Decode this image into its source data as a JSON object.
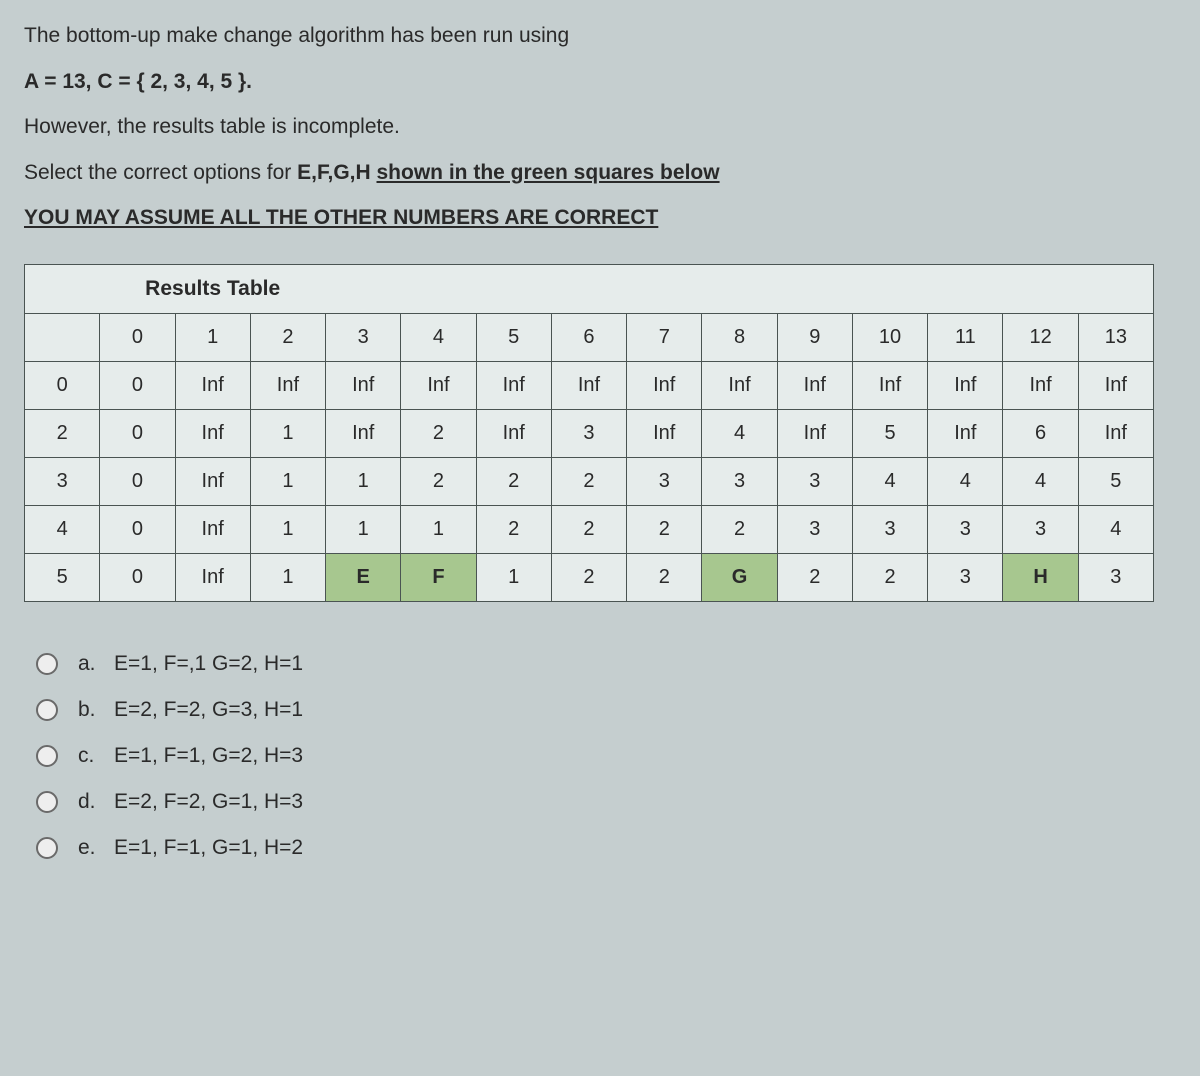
{
  "question": {
    "line1": "The bottom-up make change algorithm has been run using",
    "line2": "A = 13, C = { 2, 3, 4, 5 }.",
    "line3": "However, the results table is incomplete.",
    "line4_prefix": "Select the correct options for ",
    "line4_bold": "E,F,G,H ",
    "line4_underline": "shown in the green squares below",
    "line5": "YOU MAY ASSUME ALL THE OTHER NUMBERS ARE CORRECT"
  },
  "table": {
    "title": "Results Table",
    "col_headers": [
      "0",
      "1",
      "2",
      "3",
      "4",
      "5",
      "6",
      "7",
      "8",
      "9",
      "10",
      "11",
      "12",
      "13"
    ],
    "rows": [
      {
        "label": "0",
        "cells": [
          "0",
          "Inf",
          "Inf",
          "Inf",
          "Inf",
          "Inf",
          "Inf",
          "Inf",
          "Inf",
          "Inf",
          "Inf",
          "Inf",
          "Inf",
          "Inf"
        ],
        "green_indices": []
      },
      {
        "label": "2",
        "cells": [
          "0",
          "Inf",
          "1",
          "Inf",
          "2",
          "Inf",
          "3",
          "Inf",
          "4",
          "Inf",
          "5",
          "Inf",
          "6",
          "Inf"
        ],
        "green_indices": []
      },
      {
        "label": "3",
        "cells": [
          "0",
          "Inf",
          "1",
          "1",
          "2",
          "2",
          "2",
          "3",
          "3",
          "3",
          "4",
          "4",
          "4",
          "5"
        ],
        "green_indices": []
      },
      {
        "label": "4",
        "cells": [
          "0",
          "Inf",
          "1",
          "1",
          "1",
          "2",
          "2",
          "2",
          "2",
          "3",
          "3",
          "3",
          "3",
          "4"
        ],
        "green_indices": []
      },
      {
        "label": "5",
        "cells": [
          "0",
          "Inf",
          "1",
          "E",
          "F",
          "1",
          "2",
          "2",
          "G",
          "2",
          "2",
          "3",
          "H",
          "3"
        ],
        "green_indices": [
          3,
          4,
          8,
          12
        ]
      }
    ]
  },
  "options": [
    {
      "letter": "a.",
      "text": "E=1, F=,1 G=2, H=1"
    },
    {
      "letter": "b.",
      "text": "E=2, F=2, G=3, H=1"
    },
    {
      "letter": "c.",
      "text": "E=1, F=1, G=2, H=3"
    },
    {
      "letter": "d.",
      "text": "E=2, F=2, G=1, H=3"
    },
    {
      "letter": "e.",
      "text": "E=1, F=1, G=1, H=2"
    }
  ],
  "chart_data": {
    "type": "table",
    "title": "Results Table",
    "columns": [
      0,
      1,
      2,
      3,
      4,
      5,
      6,
      7,
      8,
      9,
      10,
      11,
      12,
      13
    ],
    "row_labels": [
      0,
      2,
      3,
      4,
      5
    ],
    "data": [
      [
        0,
        "Inf",
        "Inf",
        "Inf",
        "Inf",
        "Inf",
        "Inf",
        "Inf",
        "Inf",
        "Inf",
        "Inf",
        "Inf",
        "Inf",
        "Inf"
      ],
      [
        0,
        "Inf",
        1,
        "Inf",
        2,
        "Inf",
        3,
        "Inf",
        4,
        "Inf",
        5,
        "Inf",
        6,
        "Inf"
      ],
      [
        0,
        "Inf",
        1,
        1,
        2,
        2,
        2,
        3,
        3,
        3,
        4,
        4,
        4,
        5
      ],
      [
        0,
        "Inf",
        1,
        1,
        1,
        2,
        2,
        2,
        2,
        3,
        3,
        3,
        3,
        4
      ],
      [
        0,
        "Inf",
        1,
        "E",
        "F",
        1,
        2,
        2,
        "G",
        2,
        2,
        3,
        "H",
        3
      ]
    ],
    "unknowns": [
      "E",
      "F",
      "G",
      "H"
    ],
    "unknown_positions": {
      "E": [
        4,
        3
      ],
      "F": [
        4,
        4
      ],
      "G": [
        4,
        8
      ],
      "H": [
        4,
        12
      ]
    }
  }
}
